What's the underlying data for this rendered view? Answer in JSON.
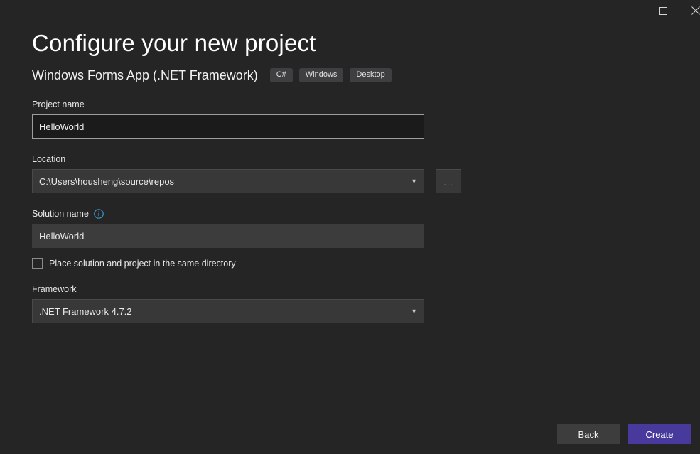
{
  "window": {
    "controls": [
      {
        "name": "minimize-button",
        "icon": "minimize-icon",
        "label": "—"
      },
      {
        "name": "maximize-button",
        "icon": "maximize-icon",
        "label": "□"
      },
      {
        "name": "close-button",
        "icon": "close-icon",
        "label": "×"
      }
    ]
  },
  "page": {
    "title": "Configure your new project",
    "subtitle": "Windows Forms App (.NET Framework)",
    "tags": [
      "C#",
      "Windows",
      "Desktop"
    ]
  },
  "fields": {
    "project_name": {
      "label": "Project name",
      "value": "HelloWorld",
      "placeholder": ""
    },
    "location": {
      "label": "Location",
      "value": "C:\\Users\\housheng\\source\\repos",
      "dropdown_icon": "chevron-down-icon",
      "browse_label": "...",
      "browse_icon": "ellipsis-icon"
    },
    "solution_name": {
      "label": "Solution name",
      "info_icon": "info-icon",
      "value": "HelloWorld",
      "placeholder": ""
    },
    "same_directory": {
      "label": "Place solution and project in the same directory",
      "checked": false
    },
    "framework": {
      "label": "Framework",
      "value": ".NET Framework 4.7.2",
      "dropdown_icon": "chevron-down-icon"
    }
  },
  "footer": {
    "back_label": "Back",
    "create_label": "Create"
  },
  "colors": {
    "background": "#252526",
    "field_background": "#3c3c3c",
    "input_background": "#1b1b1c",
    "accent": "#473a9c",
    "info_blue": "#3399cc",
    "text": "#f0f0f0"
  }
}
